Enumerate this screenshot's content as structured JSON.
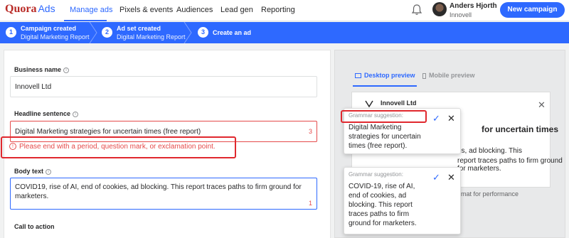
{
  "app": {
    "brand": "Quora",
    "product": "Ads"
  },
  "nav": [
    "Manage ads",
    "Pixels & events",
    "Audiences",
    "Lead gen",
    "Reporting"
  ],
  "user": {
    "name": "Anders Hjorth",
    "org": "Innovell"
  },
  "new_campaign_label": "New campaign",
  "steps": [
    {
      "num": "1",
      "title": "Campaign created",
      "sub": "Digital Marketing Report"
    },
    {
      "num": "2",
      "title": "Ad set created",
      "sub": "Digital Marketing Report"
    },
    {
      "num": "3",
      "title": "Create an ad",
      "sub": ""
    }
  ],
  "form": {
    "business_label": "Business name",
    "business_value": "Innovell Ltd",
    "headline_label": "Headline sentence",
    "headline_value": "Digital Marketing strategies for uncertain times (free report)",
    "headline_count": "3",
    "error_text": "Please end with a period, question mark, or exclamation point.",
    "body_label": "Body text",
    "body_value_line1": "COVID19, rise of AI, end of cookies, ad blocking. This report traces paths to firm ground for",
    "body_value_line2": "marketers.",
    "body_count": "1",
    "cta_label": "Call to action"
  },
  "preview": {
    "tab_desktop": "Desktop preview",
    "tab_mobile": "Mobile preview",
    "company": "Innovell Ltd",
    "headline_fragment": "for uncertain times",
    "body_fragment1": "es, ad blocking. This",
    "body_fragment2": "report traces paths to firm ground for marketers.",
    "footer_fragment": "ormat for performance"
  },
  "suggestions": [
    {
      "label": "Grammar suggestion:",
      "lines": [
        "Digital Marketing",
        "strategies for uncertain",
        "times (free report)."
      ]
    },
    {
      "label": "Grammar suggestion:",
      "lines": [
        "COVID-19, rise of AI,",
        "end of cookies, ad",
        "blocking. This report",
        "traces paths to firm",
        "ground for marketers."
      ]
    }
  ],
  "colors": {
    "accent": "#2e69ff",
    "error": "#e54b4b",
    "brand": "#b92b27"
  }
}
